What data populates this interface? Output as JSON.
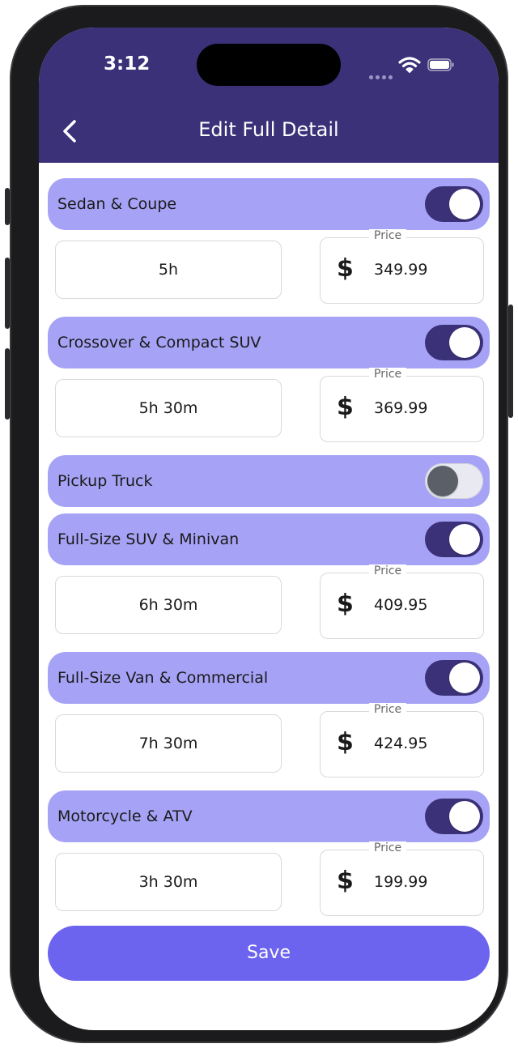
{
  "status_bar": {
    "time": "3:12"
  },
  "header": {
    "title": "Edit Full Detail"
  },
  "categories": [
    {
      "name": "Sedan & Coupe",
      "enabled": true,
      "duration": "5h",
      "price_label": "Price",
      "currency": "$",
      "price": "349.99"
    },
    {
      "name": "Crossover & Compact SUV",
      "enabled": true,
      "duration": "5h 30m",
      "price_label": "Price",
      "currency": "$",
      "price": "369.99"
    },
    {
      "name": "Pickup Truck",
      "enabled": false
    },
    {
      "name": "Full-Size SUV & Minivan",
      "enabled": true,
      "duration": "6h 30m",
      "price_label": "Price",
      "currency": "$",
      "price": "409.95"
    },
    {
      "name": "Full-Size Van & Commercial",
      "enabled": true,
      "duration": "7h 30m",
      "price_label": "Price",
      "currency": "$",
      "price": "424.95"
    },
    {
      "name": "Motorcycle & ATV",
      "enabled": true,
      "duration": "3h 30m",
      "price_label": "Price",
      "currency": "$",
      "price": "199.99"
    }
  ],
  "save_label": "Save",
  "colors": {
    "header_bg": "#3b3178",
    "category_bg": "#a6a3f6",
    "toggle_on": "#3b3178",
    "save_bg": "#6c63ef"
  },
  "icons": {
    "back": "chevron-left-icon",
    "wifi": "wifi-icon",
    "battery": "battery-icon",
    "currency": "dollar-icon"
  }
}
